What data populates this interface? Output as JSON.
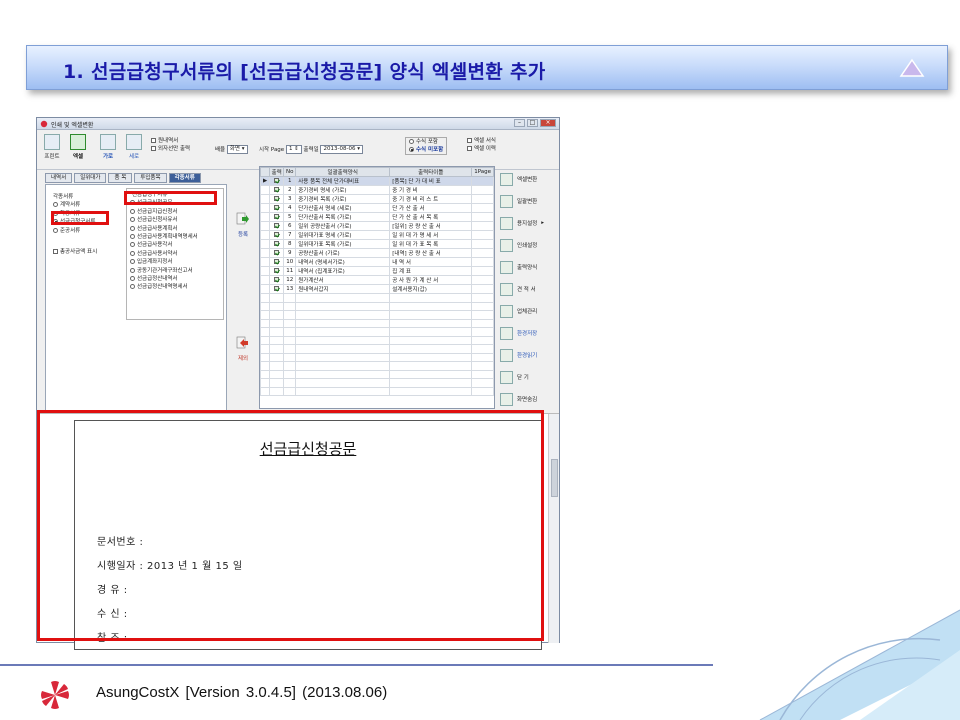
{
  "banner": {
    "title": "1. 선금급청구서류의 [선금급신청공문] 양식 엑셀변환 추가"
  },
  "window": {
    "title": "인쇄 및 엑셀변환"
  },
  "toolbar": {
    "print_label": "프린트",
    "excel_label": "엑셀",
    "landscape_label": "가로",
    "portrait_label": "세로",
    "opt1": "원내역서",
    "opt2": "외자선만 출력",
    "zoom_label": "배율",
    "zoom_value": "화면",
    "start_page_label": "시작 Page",
    "start_page_value": "1",
    "date_label": "출력일",
    "date_value": "2013-08-06",
    "radio1": "수식 포함",
    "radio2": "수식 미포함",
    "opt3": "엑셀 서식",
    "opt4": "엑셀 이력"
  },
  "tabs": [
    "내역서",
    "일위대가",
    "품 목",
    "투입품목",
    "각종서류"
  ],
  "left": {
    "group_a_title": "각종서류",
    "group_a": [
      "계약서류",
      "착공서류",
      "선금급청구서류",
      "준공서류"
    ],
    "group_c": "총공사금액 표시",
    "group_b_title": "선금급청구서류",
    "group_b": [
      "선금급신청공문",
      "선금급지급신청서",
      "선금급신청사유서",
      "선금급사용계획서",
      "선금급사용계획내역명세서",
      "선금급사용각서",
      "선금급사용서약서",
      "입금계좌지정서",
      "공동기관거래구좌신고서",
      "선금급정산내역서",
      "선금급정산내역명세서"
    ]
  },
  "mid": {
    "register": "등록",
    "remove": "제외"
  },
  "grid": {
    "headers": [
      "출력",
      "No",
      "일괄출력양식",
      "출력타이틀",
      "1Page"
    ],
    "rows": [
      {
        "no": "1",
        "name": "사용 품목 전체 단가대비표",
        "title": "[품목] 단 가 대 비 표"
      },
      {
        "no": "2",
        "name": "중기경비 명세 (가로)",
        "title": "중 기 경 비"
      },
      {
        "no": "3",
        "name": "중기경비 목록 (가로)",
        "title": "중 기 경 비 리 스 트"
      },
      {
        "no": "4",
        "name": "단가산출서 명세 (세로)",
        "title": "단 가 산 출 서"
      },
      {
        "no": "5",
        "name": "단가산출서 목록 (가로)",
        "title": "단 가 산 출 서 목 록"
      },
      {
        "no": "6",
        "name": "일위 공량산출서 (가로)",
        "title": "[일위] 공 량 산 출 서"
      },
      {
        "no": "7",
        "name": "일위대가표 명세 (가로)",
        "title": "일 위 대 가 명 세 서"
      },
      {
        "no": "8",
        "name": "일위대가표 목록 (가로)",
        "title": "일 위 대 가 표 목 록"
      },
      {
        "no": "9",
        "name": "공량산출서 (가로)",
        "title": "[내역] 공 량 산 출 서"
      },
      {
        "no": "10",
        "name": "내역서 (명세서가로)",
        "title": "내 역 서"
      },
      {
        "no": "11",
        "name": "내역서 (집계표가로)",
        "title": "집 계 표"
      },
      {
        "no": "12",
        "name": "원가계산서",
        "title": "공 사 원 가 계 산 서"
      },
      {
        "no": "13",
        "name": "원내역서갑지",
        "title": "설계서용지(갑)"
      }
    ]
  },
  "right": [
    "엑셀변환",
    "일괄변환",
    "용지설정",
    "인쇄설정",
    "출력양식",
    "견 적 서",
    "업체관리",
    "환경저장",
    "환경읽기",
    "닫 기",
    "화면숨김"
  ],
  "preview": {
    "title": "선금급신청공문",
    "lines": [
      "문서번호 :",
      "시행일자 : 2013 년 1 월 15 일",
      "경    유 :",
      "수    신 :",
      "참    조 :"
    ]
  },
  "footer": {
    "text": "AsungCostX   [Version 3.0.4.5]    (2013.08.06)"
  },
  "colors": {
    "highlight": "#e01010",
    "banner_text": "#1a1aa8",
    "active_tab": "#3d5f99"
  }
}
